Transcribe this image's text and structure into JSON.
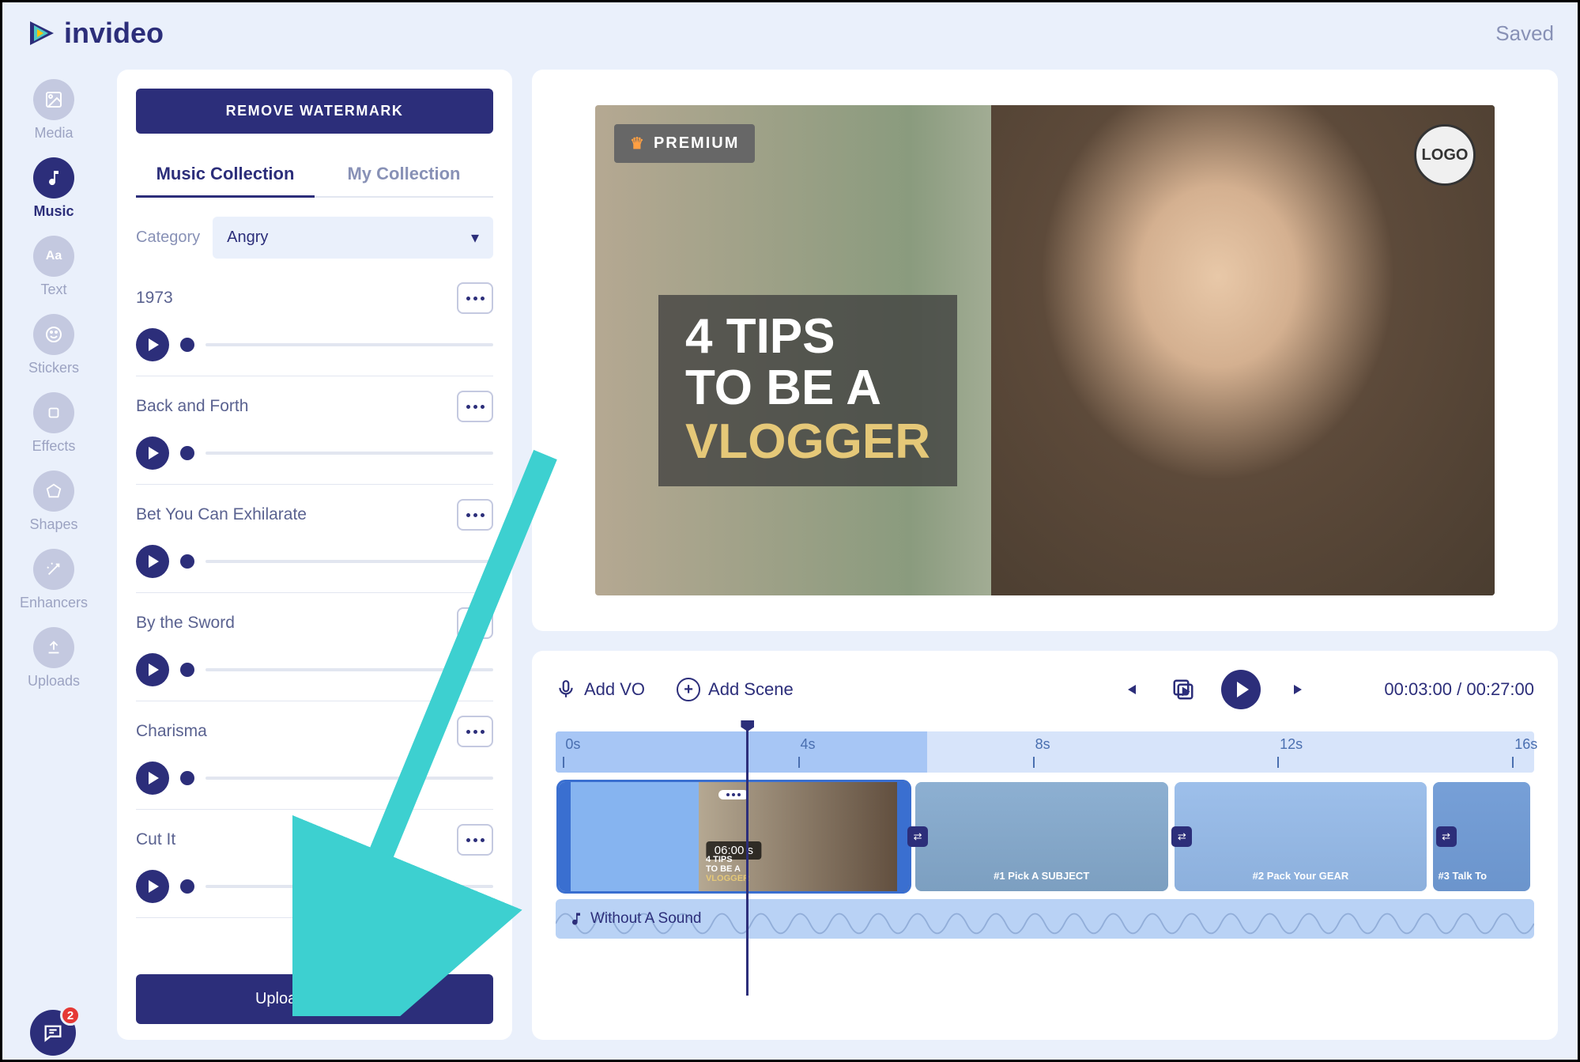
{
  "header": {
    "brand": "invideo",
    "status": "Saved"
  },
  "sidebar": {
    "items": [
      {
        "label": "Media"
      },
      {
        "label": "Music"
      },
      {
        "label": "Text"
      },
      {
        "label": "Stickers"
      },
      {
        "label": "Effects"
      },
      {
        "label": "Shapes"
      },
      {
        "label": "Enhancers"
      },
      {
        "label": "Uploads"
      }
    ],
    "chat_notifications": "2"
  },
  "music_panel": {
    "watermark_button": "REMOVE WATERMARK",
    "tabs": {
      "collection": "Music Collection",
      "my": "My Collection"
    },
    "category_label": "Category",
    "category_value": "Angry",
    "tracks": [
      {
        "title": "1973"
      },
      {
        "title": "Back and Forth"
      },
      {
        "title": "Bet You Can Exhilarate"
      },
      {
        "title": "By the Sword"
      },
      {
        "title": "Charisma"
      },
      {
        "title": "Cut It"
      }
    ],
    "upload_button": "Upload your own"
  },
  "preview": {
    "premium_badge": "PREMIUM",
    "logo_stamp": "LOGO",
    "title_line1": "4 TIPS",
    "title_line2": "TO BE A",
    "title_line3": "VLOGGER"
  },
  "timeline": {
    "add_vo": "Add VO",
    "add_scene": "Add Scene",
    "time_current": "00:03:00",
    "time_total": "00:27:00",
    "ruler_ticks": [
      "0s",
      "4s",
      "8s",
      "12s",
      "16s"
    ],
    "clips": [
      {
        "duration": "06:00 s",
        "title": "4 TIPS TO BE A VLOGGER"
      },
      {
        "caption": "#1 Pick A SUBJECT"
      },
      {
        "caption": "#2 Pack Your GEAR"
      },
      {
        "caption": "#3 Talk To"
      }
    ],
    "audio_track": "Without A Sound"
  }
}
